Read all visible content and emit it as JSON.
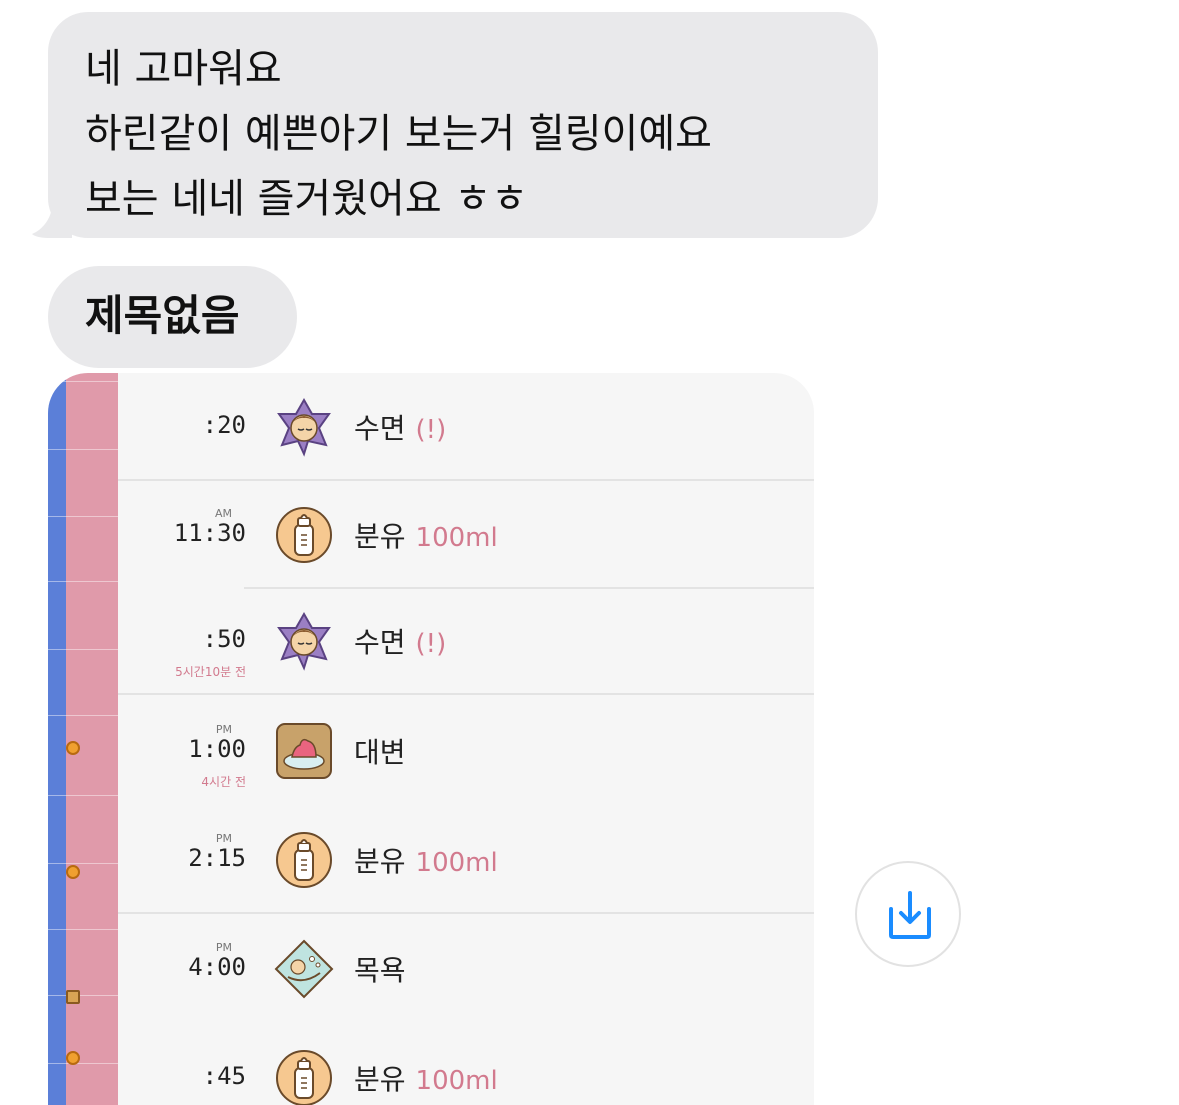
{
  "messages": {
    "incoming_text": {
      "lines": [
        "네 고마워요",
        "하린같이 예쁜아기 보는거 힐링이예요",
        "보는 네네 즐거웠어요 ㅎㅎ"
      ]
    },
    "incoming_title": "제목없음"
  },
  "attachment": {
    "entries": [
      {
        "ampm": "",
        "time": ":20",
        "sub": "",
        "icon": "sleep-icon",
        "label": "수면",
        "extra": "(!)"
      },
      {
        "ampm": "AM",
        "time": "11:30",
        "sub": "",
        "icon": "formula-bottle-icon",
        "label": "분유",
        "extra": "100ml"
      },
      {
        "ampm": "",
        "time": ":50",
        "sub": "5시간10분 전",
        "icon": "sleep-icon",
        "label": "수면",
        "extra": "(!)"
      },
      {
        "ampm": "PM",
        "time": "1:00",
        "sub": "4시간 전",
        "icon": "poop-icon",
        "label": "대변",
        "extra": ""
      },
      {
        "ampm": "PM",
        "time": "2:15",
        "sub": "",
        "icon": "formula-bottle-icon",
        "label": "분유",
        "extra": "100ml"
      },
      {
        "ampm": "PM",
        "time": "4:00",
        "sub": "",
        "icon": "bath-icon",
        "label": "목욕",
        "extra": ""
      },
      {
        "ampm": "",
        "time": ":45",
        "sub": "",
        "icon": "formula-bottle-icon",
        "label": "분유",
        "extra": "100ml"
      }
    ]
  },
  "colors": {
    "bubble": "#e9e9eb",
    "accent_pink": "#d27a8e",
    "sidebar_blue": "#5b7fd8",
    "save_blue": "#1a8cff"
  },
  "save_button": {
    "icon": "save-download-icon"
  }
}
